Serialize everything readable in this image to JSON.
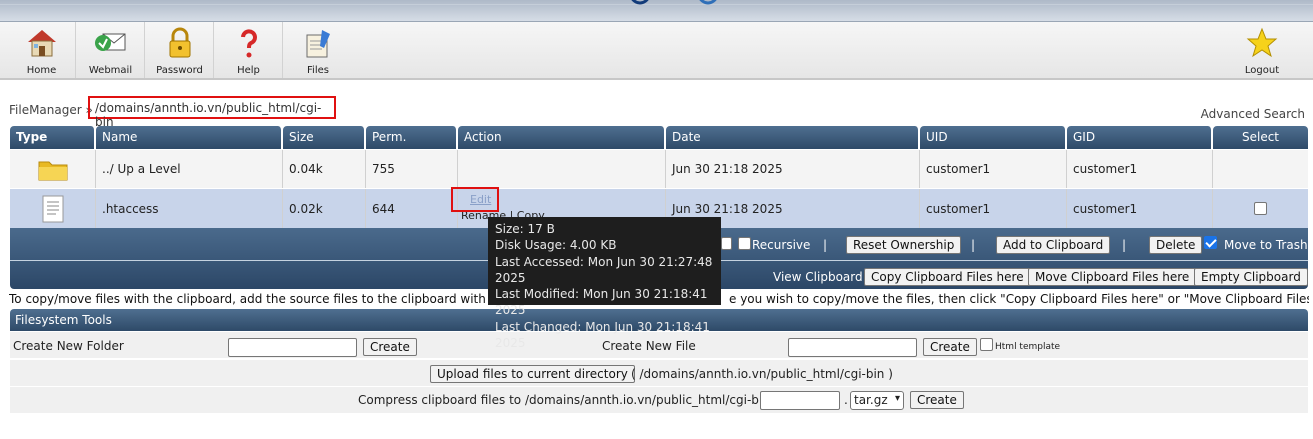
{
  "nav": {
    "items": [
      {
        "label": "Home",
        "icon": "home-icon"
      },
      {
        "label": "Webmail",
        "icon": "webmail-icon"
      },
      {
        "label": "Password",
        "icon": "lock-icon"
      },
      {
        "label": "Help",
        "icon": "help-icon"
      },
      {
        "label": "Files",
        "icon": "files-icon"
      }
    ],
    "logout": "Logout"
  },
  "breadcrumb": {
    "root": "FileManager »",
    "path": "/domains/annth.io.vn/public_html/cgi-bin"
  },
  "advanced_search": "Advanced Search",
  "table": {
    "headers": [
      "Type",
      "Name",
      "Size",
      "Perm.",
      "Action",
      "Date",
      "UID",
      "GID",
      "Select"
    ],
    "rows": [
      {
        "type": "folder",
        "name": "../ Up a Level",
        "size": "0.04k",
        "perm": "755",
        "date": "Jun 30 21:18 2025",
        "uid": "customer1",
        "gid": "customer1"
      },
      {
        "type": "file",
        "name": ".htaccess",
        "size": "0.02k",
        "perm": "644",
        "action_edit": "Edit",
        "action_more": "Rename | Copy",
        "date": "Jun 30 21:18 2025",
        "uid": "customer1",
        "gid": "customer1",
        "selected": false
      }
    ]
  },
  "clipboard": {
    "recursive": "Recursive",
    "sep": "|",
    "reset_ownership": "Reset Ownership",
    "add_to_clipboard": "Add to Clipboard",
    "delete": "Delete",
    "move_to_trash": "Move to Trash",
    "view_clipboard": "View Clipboard",
    "copy_here": "Copy Clipboard Files here",
    "move_here": "Move Clipboard Files here",
    "empty": "Empty Clipboard"
  },
  "note_left": "To copy/move files with the clipboard, add the source files to the clipboard with \"Ad",
  "note_right": "e you wish to copy/move the files, then click \"Copy Clipboard Files here\" or \"Move Clipboard Files here\"",
  "filesystem_tools": {
    "title": "Filesystem Tools",
    "create_folder_label": "Create New Folder",
    "create_button": "Create",
    "create_file_label": "Create New File",
    "html_template": "Html template",
    "upload_button": "Upload files to current directory",
    "upload_path": "( /domains/annth.io.vn/public_html/cgi-bin )",
    "compress_label": "Compress clipboard files to /domains/annth.io.vn/public_html/cgi-bin/",
    "compress_dot": ".",
    "compress_format": "tar.gz"
  },
  "tooltip": {
    "size": "Size: 17 B",
    "disk_usage": "Disk Usage: 4.00 KB",
    "last_accessed": "Last Accessed: Mon Jun 30 21:27:48 2025",
    "last_modified": "Last Modified: Mon Jun 30 21:18:41 2025",
    "last_changed": "Last Changed: Mon Jun 30 21:18:41 2025"
  },
  "colors": {
    "header": "#3b5a7b",
    "selected_row": "#c8d4ea",
    "highlight_box": "#e01010",
    "tooltip_bg": "#1e1e1e"
  }
}
